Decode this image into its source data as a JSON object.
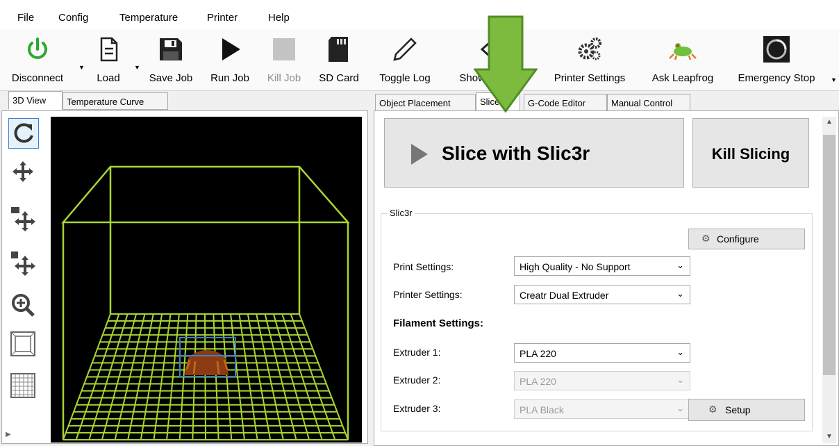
{
  "menu": [
    "File",
    "Config",
    "Temperature",
    "Printer",
    "Help"
  ],
  "toolbar": {
    "disconnect": "Disconnect",
    "load": "Load",
    "save_job": "Save Job",
    "run_job": "Run Job",
    "kill_job": "Kill Job",
    "sd_card": "SD Card",
    "toggle_log": "Toggle Log",
    "show_filament": "Show Filament",
    "printer_settings": "Printer Settings",
    "ask_leapfrog": "Ask Leapfrog",
    "emergency_stop": "Emergency Stop"
  },
  "left_tabs": [
    "3D View",
    "Temperature Curve"
  ],
  "right_tabs": [
    "Object Placement",
    "Slicer",
    "G-Code Editor",
    "Manual Control"
  ],
  "slicer": {
    "slice_button": "Slice with Slic3r",
    "kill_button": "Kill Slicing",
    "group_title": "Slic3r",
    "configure_button": "Configure",
    "print_settings_label": "Print Settings:",
    "print_settings_value": "High Quality - No Support",
    "printer_settings_label": "Printer Settings:",
    "printer_settings_value": "Creatr Dual Extruder",
    "filament_heading": "Filament Settings:",
    "extruder1_label": "Extruder 1:",
    "extruder1_value": "PLA 220",
    "extruder2_label": "Extruder 2:",
    "extruder2_value": "PLA 220",
    "extruder3_label": "Extruder 3:",
    "extruder3_value": "PLA Black",
    "setup_button": "Setup"
  },
  "colors": {
    "grid_green": "#a8d630",
    "arrow_green": "#7dbb3f",
    "selection_blue": "#3a7fd5",
    "power_green": "#2ea82e"
  }
}
